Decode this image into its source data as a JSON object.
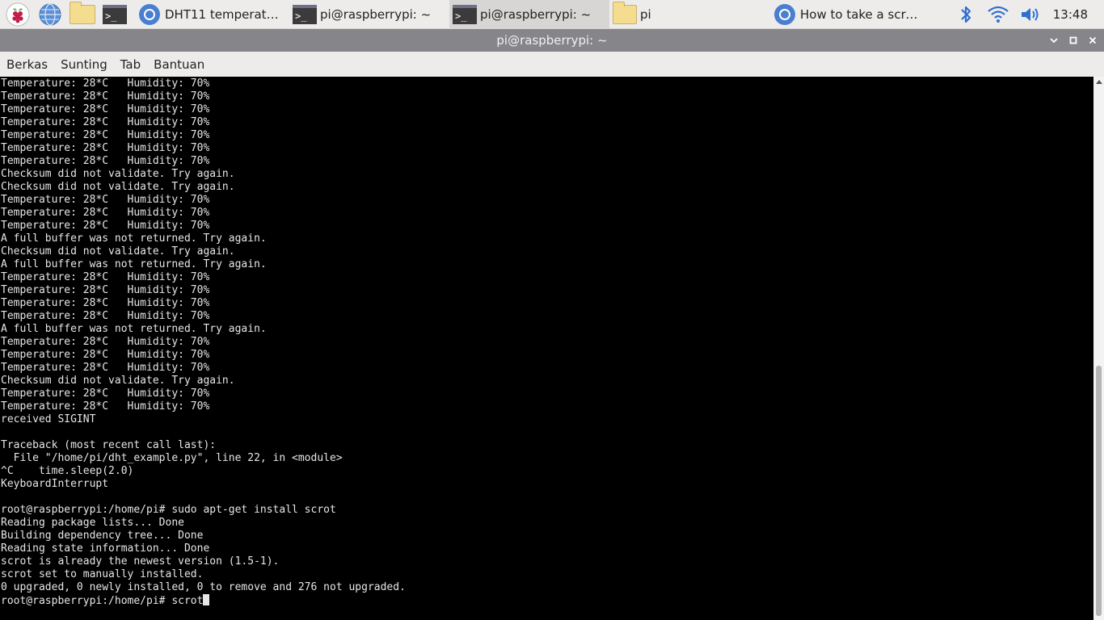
{
  "taskbar": {
    "tasks": [
      {
        "label": "DHT11 temperature ...",
        "icon": "chrome-icon"
      },
      {
        "label": "pi@raspberrypi: ~",
        "icon": "terminal-icon"
      },
      {
        "label": "pi@raspberrypi: ~",
        "icon": "terminal-icon",
        "active": true
      },
      {
        "label": "pi",
        "icon": "folder-icon"
      },
      {
        "label": "How to take a screen...",
        "icon": "chrome-icon"
      }
    ],
    "clock": "13:48"
  },
  "window": {
    "title": "pi@raspberrypi: ~"
  },
  "menu": {
    "items": [
      "Berkas",
      "Sunting",
      "Tab",
      "Bantuan"
    ]
  },
  "terminal": {
    "lines": [
      "Temperature: 28*C   Humidity: 70%",
      "Temperature: 28*C   Humidity: 70%",
      "Temperature: 28*C   Humidity: 70%",
      "Temperature: 28*C   Humidity: 70%",
      "Temperature: 28*C   Humidity: 70%",
      "Temperature: 28*C   Humidity: 70%",
      "Temperature: 28*C   Humidity: 70%",
      "Checksum did not validate. Try again.",
      "Checksum did not validate. Try again.",
      "Temperature: 28*C   Humidity: 70%",
      "Temperature: 28*C   Humidity: 70%",
      "Temperature: 28*C   Humidity: 70%",
      "A full buffer was not returned. Try again.",
      "Checksum did not validate. Try again.",
      "A full buffer was not returned. Try again.",
      "Temperature: 28*C   Humidity: 70%",
      "Temperature: 28*C   Humidity: 70%",
      "Temperature: 28*C   Humidity: 70%",
      "Temperature: 28*C   Humidity: 70%",
      "A full buffer was not returned. Try again.",
      "Temperature: 28*C   Humidity: 70%",
      "Temperature: 28*C   Humidity: 70%",
      "Temperature: 28*C   Humidity: 70%",
      "Checksum did not validate. Try again.",
      "Temperature: 28*C   Humidity: 70%",
      "Temperature: 28*C   Humidity: 70%",
      "received SIGINT",
      "",
      "Traceback (most recent call last):",
      "  File \"/home/pi/dht_example.py\", line 22, in <module>",
      "^C    time.sleep(2.0)",
      "KeyboardInterrupt",
      "",
      "root@raspberrypi:/home/pi# sudo apt-get install scrot",
      "Reading package lists... Done",
      "Building dependency tree... Done",
      "Reading state information... Done",
      "scrot is already the newest version (1.5-1).",
      "scrot set to manually installed.",
      "0 upgraded, 0 newly installed, 0 to remove and 276 not upgraded."
    ],
    "prompt_line": "root@raspberrypi:/home/pi# scrot"
  }
}
